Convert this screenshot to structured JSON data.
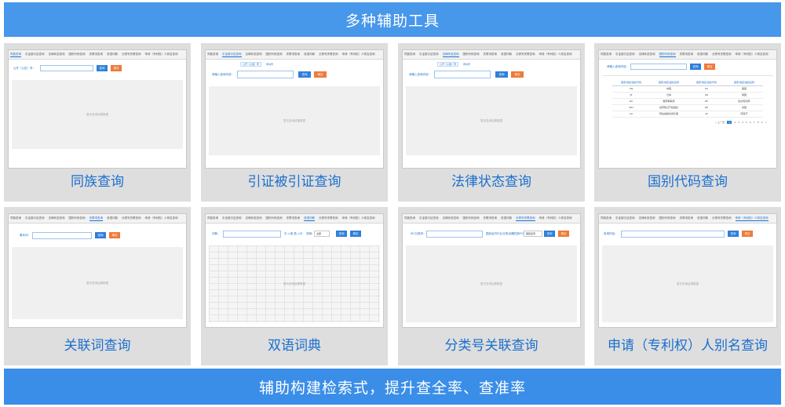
{
  "header": {
    "title": "多种辅助工具"
  },
  "footer": {
    "slogan": "辅助构建检索式，提升查全率、查准率"
  },
  "tabs": [
    "同族查询",
    "引证被引证查询",
    "法律状态查询",
    "国别代码查询",
    "关联词查询",
    "双语词典",
    "分类号关联查询",
    "申请（专利权）人别名查询"
  ],
  "empty_text": "暂无查询结果数据",
  "buttons": {
    "query": "查询",
    "clear": "清空"
  },
  "cards": [
    {
      "label": "同族查询",
      "active_tab": 0,
      "field_label": "公开（公告）号："
    },
    {
      "label": "引证被引证查询",
      "active_tab": 1,
      "field_label": "请输入查询内容：",
      "chips": [
        "公开（公告）号",
        "申请号"
      ]
    },
    {
      "label": "法律状态查询",
      "active_tab": 2,
      "field_label": "请输入查询内容：",
      "chips": [
        "公开（公告）号",
        "申请号"
      ]
    },
    {
      "label": "国别代码查询",
      "active_tab": 3,
      "field_label": "请输入查询内容：",
      "table_headers": [
        "国家/地区/组织代码",
        "国家/地区/组织名称",
        "国家/地区/组织代码",
        "国家/地区/组织名称"
      ],
      "table_rows": [
        [
          "CN",
          "中国",
          "US",
          "美国"
        ],
        [
          "JP",
          "日本",
          "KR",
          "韩国"
        ],
        [
          "RU",
          "俄罗斯联邦",
          "EP",
          "欧洲专利局"
        ],
        [
          "WO",
          "世界知识产权组织",
          "DE",
          "德国"
        ],
        [
          "AU",
          "阿拉伯联合酋长国",
          "AF",
          "阿富汗"
        ]
      ],
      "pager": {
        "prev": "< 上一页",
        "pages": [
          "1",
          "2",
          "3",
          "4",
          "5",
          "6",
          "7",
          "8",
          "9"
        ],
        "next": ">"
      }
    },
    {
      "label": "关联词查询",
      "active_tab": 4,
      "field_label": "基本词："
    },
    {
      "label": "双语词典",
      "active_tab": 5,
      "field_label": "词典：",
      "options": "中->英  英->中",
      "select_label": "领域：",
      "select_value": "全部"
    },
    {
      "label": "分类号关联查询",
      "active_tab": 6,
      "field_label": "IPC分类号：",
      "select_label": "国民经济行业分类/战略性新兴产业：",
      "select_value": "国民经济"
    },
    {
      "label": "申请（专利权）人别名查询",
      "active_tab": 7,
      "field_label": "查询内容："
    }
  ]
}
